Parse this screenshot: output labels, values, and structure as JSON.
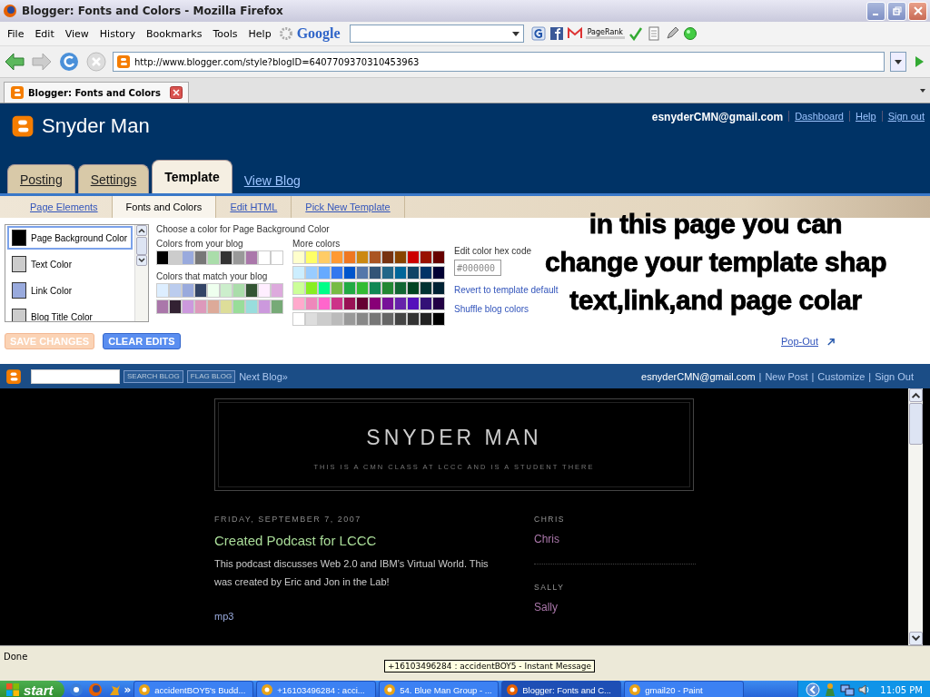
{
  "window": {
    "title": "Blogger: Fonts and Colors - Mozilla Firefox"
  },
  "menu": [
    "File",
    "Edit",
    "View",
    "History",
    "Bookmarks",
    "Tools",
    "Help"
  ],
  "search_toolbar": {
    "brand": "Google",
    "page_rank": "PageRank"
  },
  "address": {
    "url": "http://www.blogger.com/style?blogID=6407709370310453963"
  },
  "tabs": [
    {
      "label": "Blogger: Fonts and Colors",
      "selected": true
    }
  ],
  "blogger": {
    "blog_name": "Snyder Man",
    "account": "esnyderCMN@gmail.com",
    "account_links": [
      "Dashboard",
      "Help",
      "Sign out"
    ],
    "main_tabs": [
      {
        "label": "Posting",
        "kind": "tab",
        "selected": false
      },
      {
        "label": "Settings",
        "kind": "tab",
        "selected": false
      },
      {
        "label": "Template",
        "kind": "tab",
        "selected": true
      },
      {
        "label": "View Blog",
        "kind": "link",
        "selected": false
      }
    ],
    "sub_tabs": [
      {
        "label": "Page Elements",
        "selected": false
      },
      {
        "label": "Fonts and Colors",
        "selected": true
      },
      {
        "label": "Edit HTML",
        "selected": false
      },
      {
        "label": "Pick New Template",
        "selected": false
      }
    ]
  },
  "color_editor": {
    "elements": [
      {
        "label": "Page Background Color",
        "color": "#000000",
        "selected": true
      },
      {
        "label": "Text Color",
        "color": "#cccccc",
        "selected": false
      },
      {
        "label": "Link Color",
        "color": "#99aadd",
        "selected": false
      },
      {
        "label": "Blog Title Color",
        "color": "#cccccc",
        "selected": false
      }
    ],
    "prompt": "Choose a color for Page Background Color",
    "blog_colors_label": "Colors from your blog",
    "blog_colors": [
      {
        "color": "#000000"
      },
      {
        "color": "#cccccc"
      },
      {
        "color": "#99aadd"
      },
      {
        "color": "#777777"
      },
      {
        "color": "#aaddaa"
      },
      {
        "color": "#333333"
      },
      {
        "color": "#999999"
      },
      {
        "color": "#aa77aa"
      },
      {
        "color": "#ffffff"
      },
      {
        "color": "#ffffff"
      }
    ],
    "match_label": "Colors that match your blog",
    "match_colors": [
      [
        {
          "color": "#ddeeff"
        },
        {
          "color": "#bbccee"
        },
        {
          "color": "#99aadd"
        },
        {
          "color": "#334466"
        },
        {
          "color": "#eeffee"
        },
        {
          "color": "#cceecc"
        },
        {
          "color": "#aaddaa"
        },
        {
          "color": "#335533"
        },
        {
          "color": "#ffeeff"
        },
        {
          "color": "#ddaadd"
        }
      ],
      [
        {
          "color": "#aa77aa"
        },
        {
          "color": "#332233"
        },
        {
          "color": "#cc99dd"
        },
        {
          "color": "#dd99bb"
        },
        {
          "color": "#ddaa99"
        },
        {
          "color": "#dddd99"
        },
        {
          "color": "#99dd99"
        },
        {
          "color": "#99dddd"
        },
        {
          "color": "#cc99dd"
        },
        {
          "color": "#77aa77"
        }
      ]
    ],
    "more_label": "More colors",
    "more_colors": [
      [
        {
          "color": "#ffffcc"
        },
        {
          "color": "#ffff66"
        },
        {
          "color": "#ffcc66"
        },
        {
          "color": "#ff9933"
        },
        {
          "color": "#ee7722"
        },
        {
          "color": "#cc8811"
        },
        {
          "color": "#aa5522"
        },
        {
          "color": "#773311"
        },
        {
          "color": "#884400"
        },
        {
          "color": "#cc0000"
        },
        {
          "color": "#991100"
        },
        {
          "color": "#660000"
        }
      ],
      [
        {
          "color": "#cceeff"
        },
        {
          "color": "#99ccff"
        },
        {
          "color": "#66aaff"
        },
        {
          "color": "#3377ee"
        },
        {
          "color": "#0055cc"
        },
        {
          "color": "#5577aa"
        },
        {
          "color": "#335577"
        },
        {
          "color": "#226688"
        },
        {
          "color": "#006699"
        },
        {
          "color": "#114466"
        },
        {
          "color": "#003366"
        },
        {
          "color": "#000033"
        }
      ],
      [
        {
          "color": "#ccff99"
        },
        {
          "color": "#88ee22"
        },
        {
          "color": "#00ff88"
        },
        {
          "color": "#77bb44"
        },
        {
          "color": "#22aa44"
        },
        {
          "color": "#33bb33"
        },
        {
          "color": "#118855"
        },
        {
          "color": "#228833"
        },
        {
          "color": "#116633"
        },
        {
          "color": "#004422"
        },
        {
          "color": "#003333"
        },
        {
          "color": "#002233"
        }
      ],
      [
        {
          "color": "#ffaacc"
        },
        {
          "color": "#ee88bb"
        },
        {
          "color": "#ff66cc"
        },
        {
          "color": "#cc3388"
        },
        {
          "color": "#991155"
        },
        {
          "color": "#660033"
        },
        {
          "color": "#880077"
        },
        {
          "color": "#771199"
        },
        {
          "color": "#6622aa"
        },
        {
          "color": "#5511bb"
        },
        {
          "color": "#331177"
        },
        {
          "color": "#220044"
        }
      ],
      [
        {
          "color": "#ffffff"
        },
        {
          "color": "#dddddd"
        },
        {
          "color": "#cccccc"
        },
        {
          "color": "#bbbbbb"
        },
        {
          "color": "#999999"
        },
        {
          "color": "#888888"
        },
        {
          "color": "#777777"
        },
        {
          "color": "#666666"
        },
        {
          "color": "#444444"
        },
        {
          "color": "#333333"
        },
        {
          "color": "#222222"
        },
        {
          "color": "#000000"
        }
      ]
    ],
    "hex_label": "Edit color hex code",
    "hex_placeholder": "#000000",
    "links": [
      "Revert to template default",
      "Shuffle blog colors"
    ]
  },
  "buttons": [
    {
      "label": "SAVE CHANGES",
      "disabled": true
    },
    {
      "label": "CLEAR EDITS",
      "disabled": false
    }
  ],
  "pop_out": "Pop-Out",
  "annotation": [
    "in this page you can",
    "change your template shap",
    "text,link,and page colar"
  ],
  "blog_navbar": {
    "buttons": [
      "SEARCH BLOG",
      "FLAG BLOG"
    ],
    "next": "Next Blog»",
    "right": [
      {
        "kind": "text",
        "label": "esnyderCMN@gmail.com"
      },
      {
        "kind": "separator",
        "label": "|"
      },
      {
        "kind": "link",
        "label": "New Post"
      },
      {
        "kind": "separator",
        "label": "|"
      },
      {
        "kind": "link",
        "label": "Customize"
      },
      {
        "kind": "separator",
        "label": "|"
      },
      {
        "kind": "link",
        "label": "Sign Out"
      }
    ]
  },
  "blog": {
    "title": "SNYDER MAN",
    "description": "THIS IS A CMN CLASS AT LCCC AND IS A STUDENT THERE",
    "post": {
      "date": "FRIDAY, SEPTEMBER 7, 2007",
      "title": "Created Podcast for LCCC",
      "body": "This podcast discusses Web 2.0 and IBM’s Virtual World. This was created by Eric and Jon in the Lab!",
      "link": "mp3"
    },
    "sidebar": [
      {
        "heading": "CHRIS",
        "link": "Chris"
      },
      {
        "heading": "SALLY",
        "link": "Sally"
      }
    ]
  },
  "status_bar": {
    "text": "Done",
    "tooltip": "+16103496284 : accidentBOY5 - Instant Message"
  },
  "taskbar": {
    "start": "start",
    "more": "»",
    "clock": "11:05 PM",
    "tasks": [
      {
        "label": "accidentBOY5's Budd...",
        "selected": false
      },
      {
        "label": "+16103496284 : acci...",
        "selected": false
      },
      {
        "label": "54. Blue Man Group - ...",
        "selected": false
      },
      {
        "label": "Blogger: Fonts and C...",
        "selected": true
      },
      {
        "label": "gmail20 - Paint",
        "selected": false
      }
    ]
  }
}
